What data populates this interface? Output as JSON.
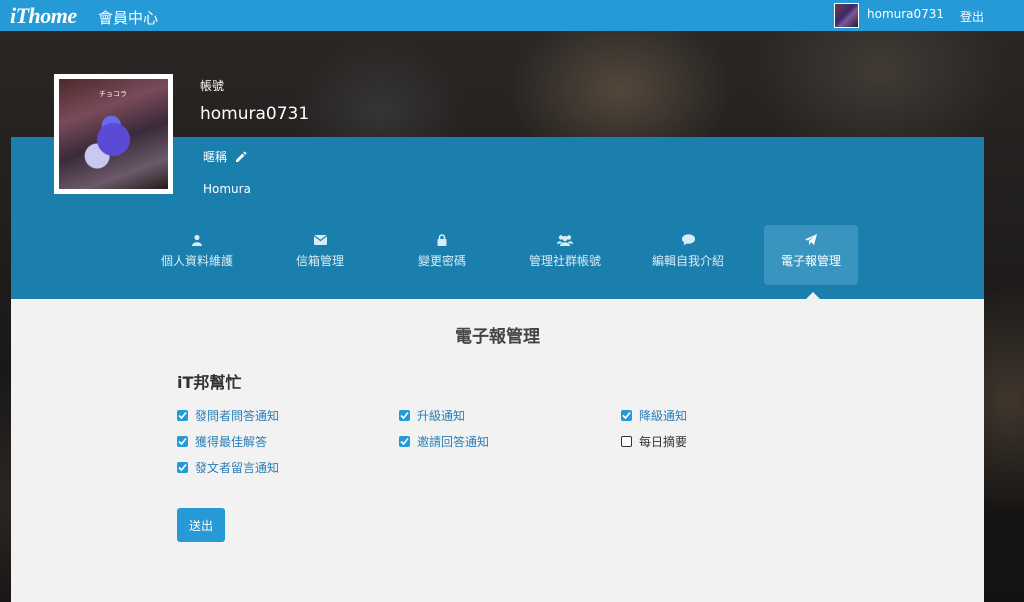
{
  "topbar": {
    "logo": "iThome",
    "brand_sub": "會員中心",
    "username": "homura0731",
    "logout": "登出"
  },
  "profile": {
    "account_label": "帳號",
    "account_name": "homura0731",
    "nickname_label": "暱稱",
    "nickname_value": "Homura",
    "avatar_tag": "チョコラ"
  },
  "tabs": [
    {
      "label": "個人資料維護",
      "icon": "user-icon"
    },
    {
      "label": "信箱管理",
      "icon": "envelope-icon"
    },
    {
      "label": "變更密碼",
      "icon": "lock-icon"
    },
    {
      "label": "管理社群帳號",
      "icon": "users-icon"
    },
    {
      "label": "編輯自我介紹",
      "icon": "comment-icon"
    },
    {
      "label": "電子報管理",
      "icon": "paper-plane-icon",
      "active": true
    }
  ],
  "main": {
    "title": "電子報管理",
    "group_title": "iT邦幫忙",
    "options": [
      {
        "label": "發問者問答通知",
        "checked": true
      },
      {
        "label": "升級通知",
        "checked": true
      },
      {
        "label": "降級通知",
        "checked": true
      },
      {
        "label": "獲得最佳解答",
        "checked": true
      },
      {
        "label": "邀請回答通知",
        "checked": true
      },
      {
        "label": "每日摘要",
        "checked": false
      },
      {
        "label": "發文者留言通知",
        "checked": true
      }
    ],
    "submit": "送出"
  },
  "colors": {
    "accent": "#259ad6",
    "panel": "#1b7fae",
    "content_bg": "#f2f2f2"
  }
}
